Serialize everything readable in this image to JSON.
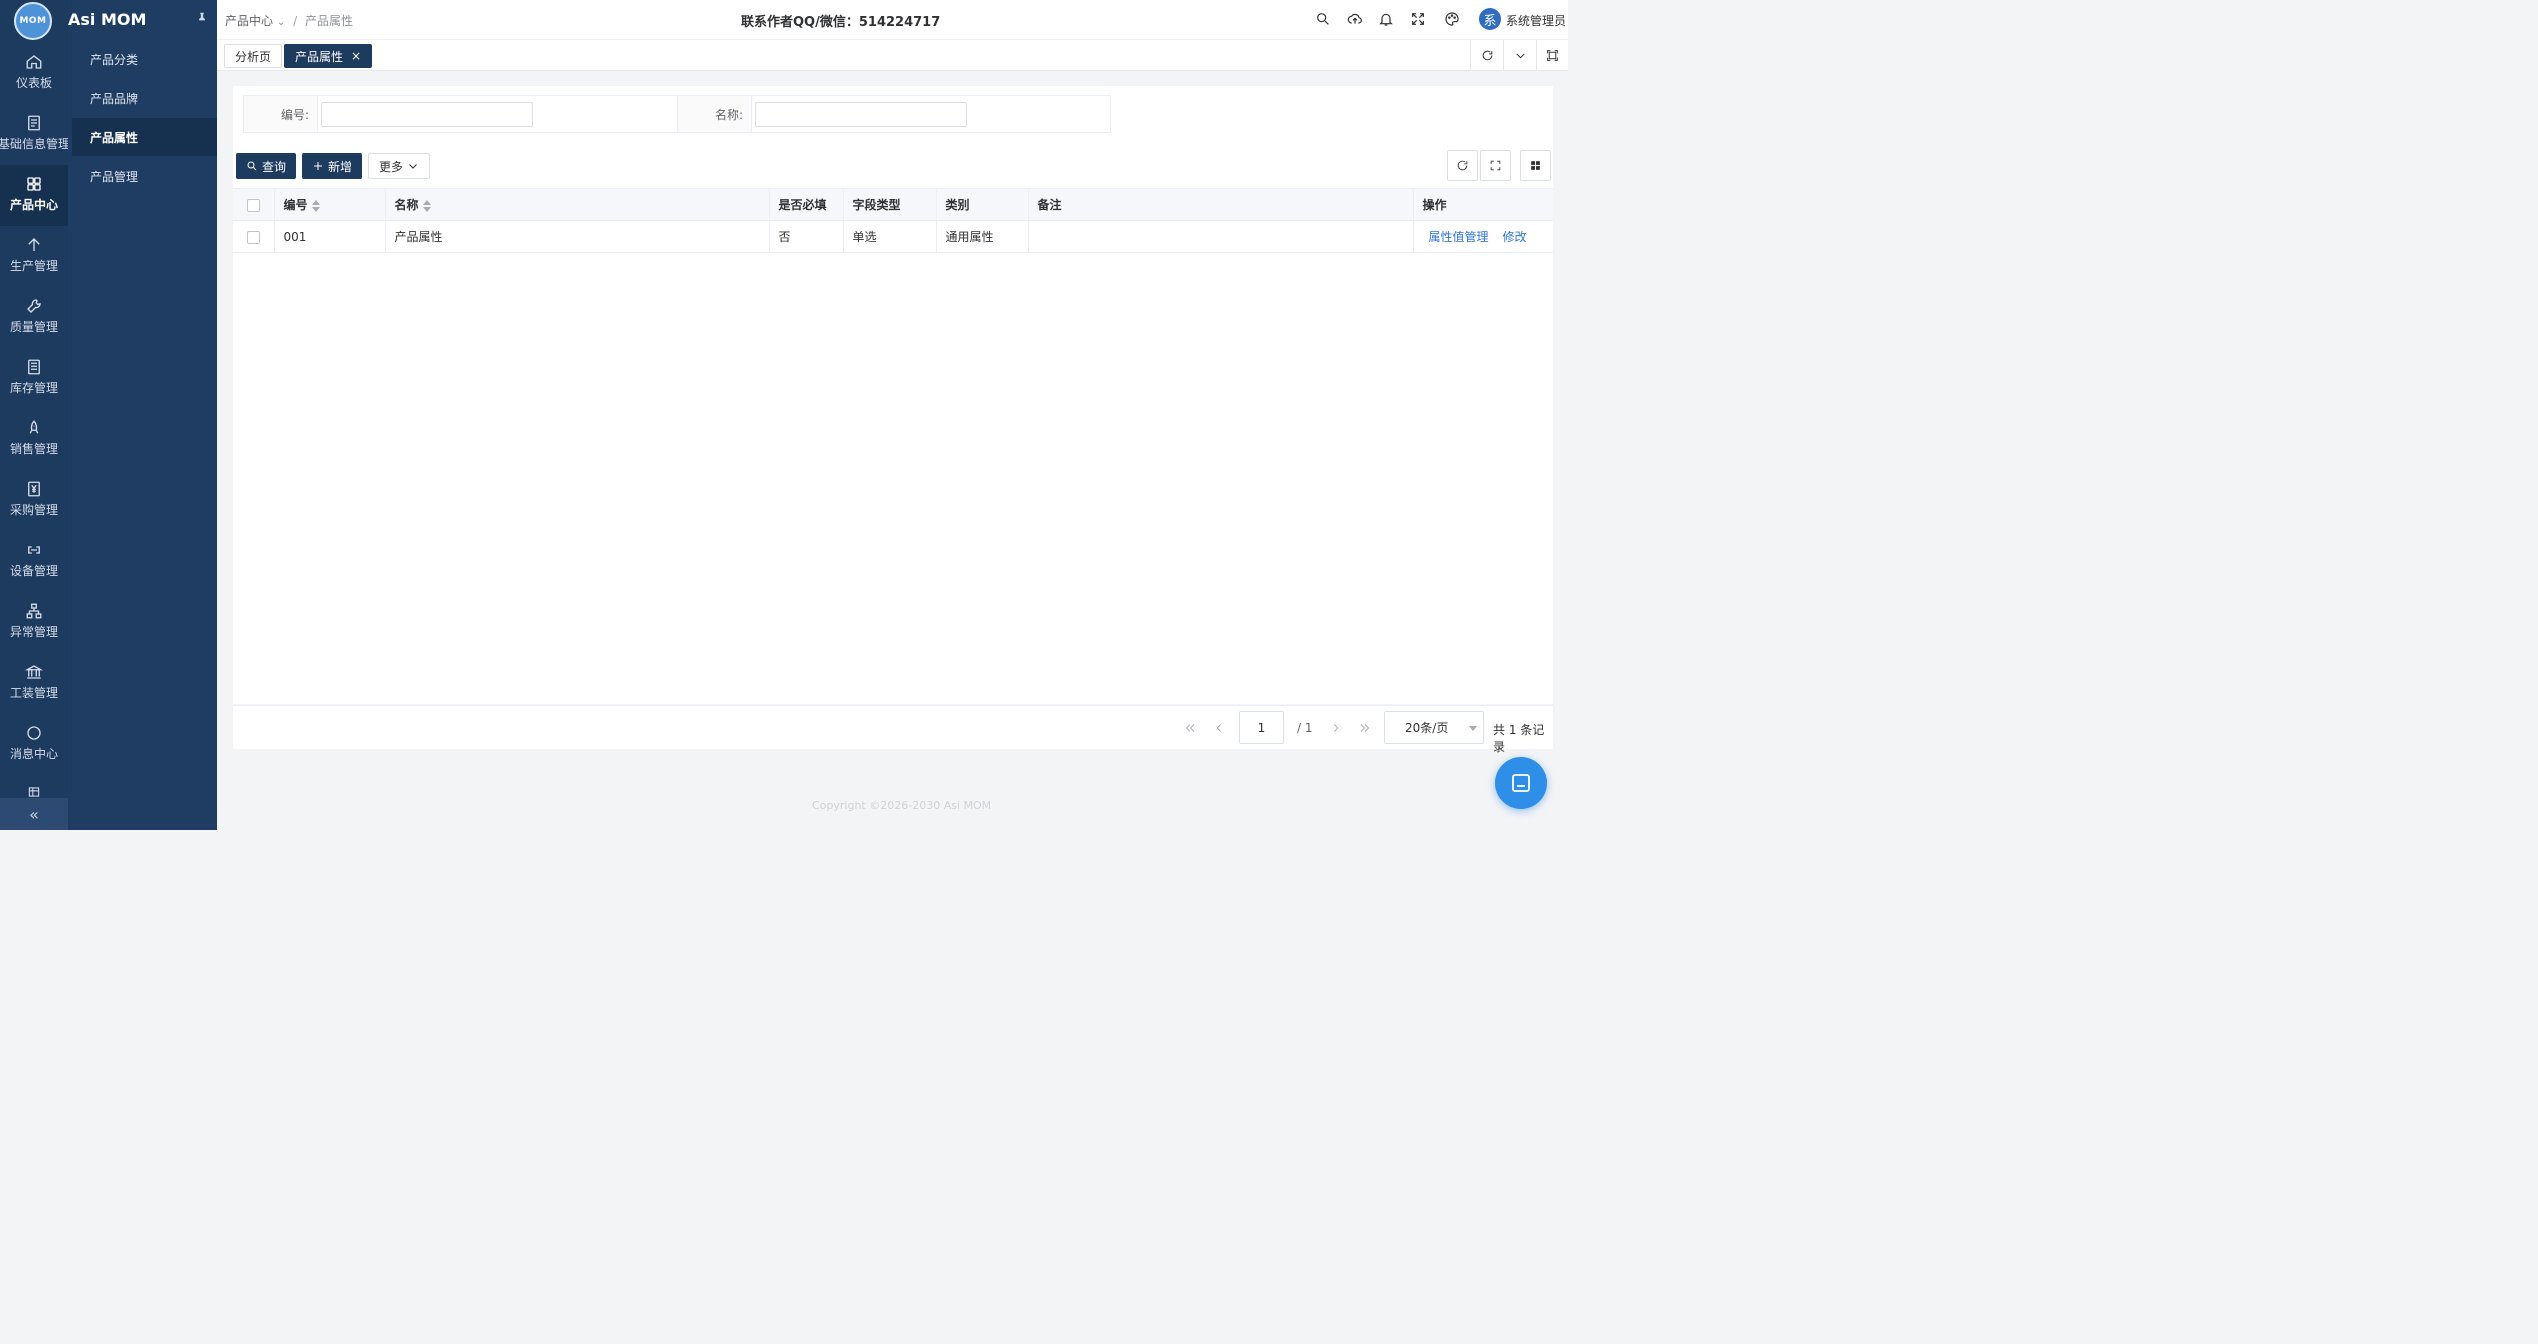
{
  "app": {
    "logo_text": "MOM",
    "title": "Asi MOM"
  },
  "rail": {
    "items": [
      {
        "label": "仪表板",
        "icon": "home-icon"
      },
      {
        "label": "基础信息管理",
        "icon": "document-icon"
      },
      {
        "label": "产品中心",
        "icon": "grid-icon",
        "active": true
      },
      {
        "label": "生产管理",
        "icon": "arrow-up-icon"
      },
      {
        "label": "质量管理",
        "icon": "wrench-icon"
      },
      {
        "label": "库存管理",
        "icon": "list-icon"
      },
      {
        "label": "销售管理",
        "icon": "rocket-icon"
      },
      {
        "label": "采购管理",
        "icon": "yen-icon"
      },
      {
        "label": "设备管理",
        "icon": "link-icon"
      },
      {
        "label": "异常管理",
        "icon": "tree-icon"
      },
      {
        "label": "工装管理",
        "icon": "bank-icon"
      },
      {
        "label": "消息中心",
        "icon": "chat-icon"
      }
    ],
    "collapse_glyph": "«"
  },
  "subnav": {
    "items": [
      {
        "label": "产品分类"
      },
      {
        "label": "产品品牌"
      },
      {
        "label": "产品属性",
        "active": true
      },
      {
        "label": "产品管理"
      }
    ]
  },
  "header": {
    "breadcrumb": {
      "root": "产品中心",
      "current": "产品属性",
      "sep": "/"
    },
    "contact": "联系作者QQ/微信：514224717",
    "avatar_text": "系",
    "username": "系统管理员"
  },
  "tabs": [
    {
      "label": "分析页",
      "active": false
    },
    {
      "label": "产品属性",
      "active": true,
      "close": "×"
    }
  ],
  "search": {
    "fields": [
      {
        "label": "编号:",
        "value": "",
        "placeholder": ""
      },
      {
        "label": "名称:",
        "value": "",
        "placeholder": ""
      }
    ]
  },
  "toolbar": {
    "query_label": "查询",
    "add_label": "新增",
    "more_label": "更多"
  },
  "table": {
    "columns": [
      "编号",
      "名称",
      "是否必填",
      "字段类型",
      "类别",
      "备注",
      "操作"
    ],
    "rows": [
      {
        "code": "001",
        "name": "产品属性",
        "required": "否",
        "field_type": "单选",
        "category": "通用属性",
        "remark": "",
        "actions": [
          "属性值管理",
          "修改"
        ]
      }
    ]
  },
  "pager": {
    "current_page": "1",
    "total_pages": "/ 1",
    "page_size": "20条/页",
    "records": "共 1 条记录"
  },
  "footer": {
    "copyright": "Copyright ©2026-2030 Asi MOM"
  },
  "colors": {
    "sidebar": "#1d3a5f",
    "primary": "#1d3a5f",
    "link": "#2f76d2",
    "float_button": "#2f8ee8"
  }
}
